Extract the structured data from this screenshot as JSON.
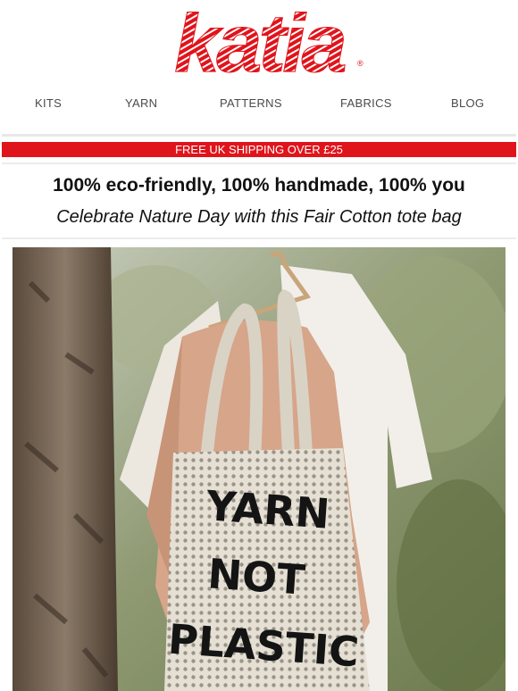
{
  "brand": {
    "logo_text": "katia",
    "registered_mark": "®",
    "color": "#e0141b"
  },
  "nav": {
    "items": [
      {
        "label": "KITS"
      },
      {
        "label": "YARN"
      },
      {
        "label": "PATTERNS"
      },
      {
        "label": "FABRICS"
      },
      {
        "label": "BLOG"
      }
    ]
  },
  "banner": {
    "text": "FREE UK SHIPPING OVER £25"
  },
  "headline": "100% eco-friendly, 100% handmade, 100% you",
  "subheadline": "Celebrate Nature Day with this Fair Cotton tote bag",
  "hero": {
    "bag_lines": [
      "YARN",
      "NOT",
      "PLASTIC"
    ]
  }
}
